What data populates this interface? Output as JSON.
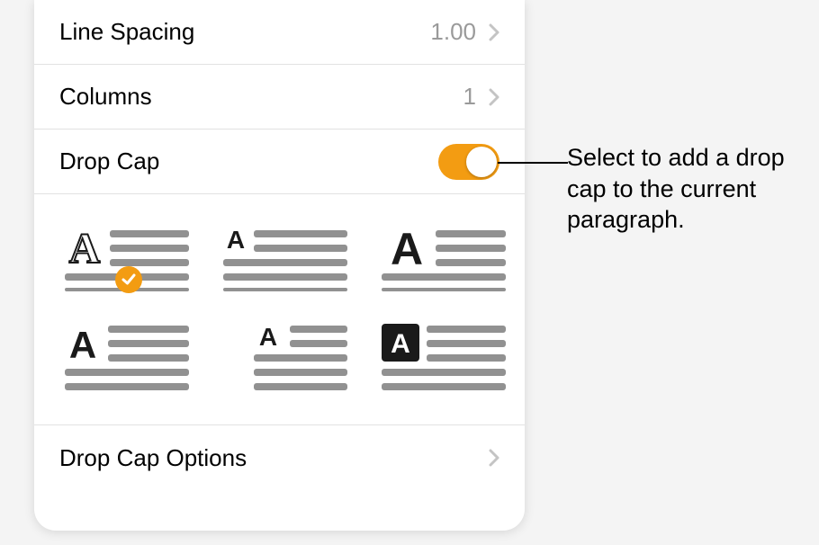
{
  "rows": {
    "line_spacing": {
      "label": "Line Spacing",
      "value": "1.00"
    },
    "columns": {
      "label": "Columns",
      "value": "1"
    },
    "drop_cap": {
      "label": "Drop Cap",
      "on": true
    },
    "options": {
      "label": "Drop Cap Options"
    }
  },
  "styles": [
    {
      "id": "dropcap-style-large-left",
      "selected": true
    },
    {
      "id": "dropcap-style-small-raised",
      "selected": false
    },
    {
      "id": "dropcap-style-bold-wide",
      "selected": false
    },
    {
      "id": "dropcap-style-margin",
      "selected": false
    },
    {
      "id": "dropcap-style-indented",
      "selected": false
    },
    {
      "id": "dropcap-style-inverse-box",
      "selected": false
    }
  ],
  "callout": "Select to add a drop cap to the current paragraph.",
  "colors": {
    "accent": "#f39c12"
  }
}
